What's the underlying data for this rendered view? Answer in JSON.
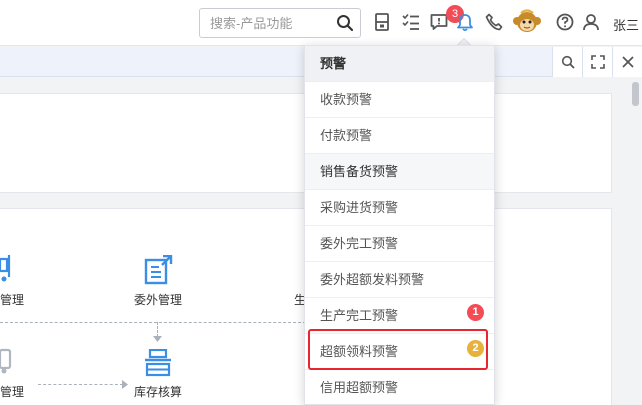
{
  "topbar": {
    "search_placeholder": "搜索-产品功能",
    "message_badge": "3",
    "username": "张三"
  },
  "flow": {
    "items": [
      {
        "label": "管理"
      },
      {
        "label": "委外管理"
      },
      {
        "label": "生"
      },
      {
        "label": "管理"
      },
      {
        "label": "库存核算"
      }
    ]
  },
  "dropdown": {
    "items": [
      {
        "label": "预警"
      },
      {
        "label": "收款预警"
      },
      {
        "label": "付款预警"
      },
      {
        "label": "销售备货预警"
      },
      {
        "label": "采购进货预警"
      },
      {
        "label": "委外完工预警"
      },
      {
        "label": "委外超额发料预警"
      },
      {
        "label": "生产完工预警"
      },
      {
        "label": "超额领料预警"
      },
      {
        "label": "信用超额预警"
      }
    ],
    "badge_one": "1",
    "badge_two": "2"
  },
  "colors": {
    "accent_blue": "#3a8ee6",
    "badge_red": "#f24c57",
    "badge_gold": "#e6b13c",
    "highlight_red": "#e8262f"
  }
}
